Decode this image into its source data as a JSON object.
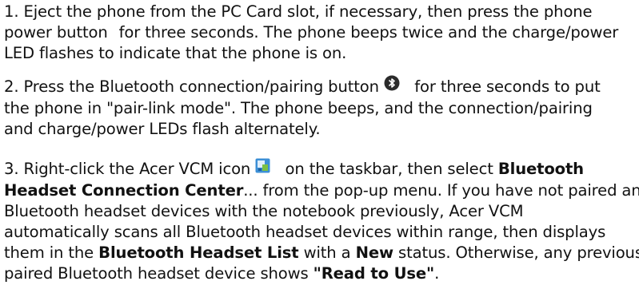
{
  "steps": [
    {
      "lines": [
        "1. Eject the phone from the PC Card slot, if necessary, then press the phone",
        "power button",
        "for three seconds. The phone beeps twice and the charge/power",
        "LED flashes to indicate that the phone is on."
      ]
    },
    {
      "lines": [
        "2. Press the Bluetooth connection/pairing button",
        "for three seconds to put",
        "the phone in \"pair-link mode\". The phone beeps, and the connection/pairing",
        "and charge/power LEDs flash alternately."
      ],
      "icon": "bluetooth-icon"
    },
    {
      "lines": [
        "3. Right-click the Acer VCM icon",
        "on the taskbar, then select",
        "Bluetooth",
        "Headset Connection Center",
        "... from the pop-up menu. If you have not paired any",
        "Bluetooth headset devices with the notebook previously, Acer VCM",
        "automatically scans all Bluetooth headset devices within range, then displays",
        "them in the",
        "Bluetooth Headset List",
        "with a",
        "New",
        "status. Otherwise, any previously",
        "paired Bluetooth headset device shows",
        "\"Read to Use\"",
        "."
      ],
      "icon": "acer-vcm-icon"
    }
  ],
  "colors": {
    "text": "#111111",
    "bluetooth_icon_bg": "#2b2b2b",
    "vcm_icon_bg": "#3c8fd6",
    "vcm_icon_accent": "#7bc043"
  }
}
